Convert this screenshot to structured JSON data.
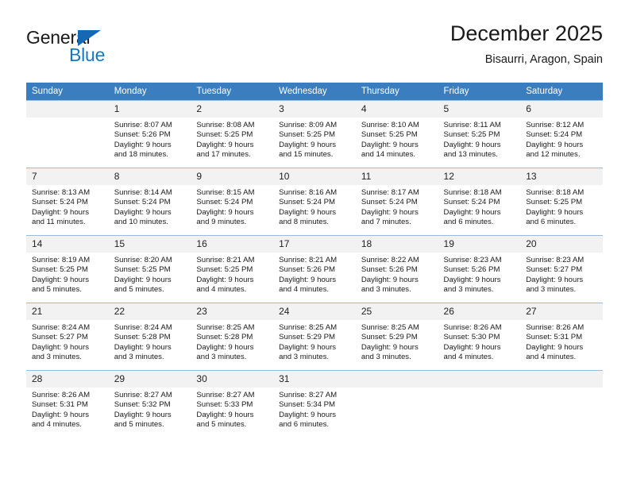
{
  "brand": {
    "name_part1": "General",
    "name_part2": "Blue",
    "accent_color": "#1479c4",
    "triangle_color": "#1668b3"
  },
  "header": {
    "title": "December 2025",
    "subtitle": "Bisaurri, Aragon, Spain"
  },
  "calendar": {
    "header_bg": "#3a7ebf",
    "daynum_bg": "#f2f2f2",
    "weekday_headers": [
      "Sunday",
      "Monday",
      "Tuesday",
      "Wednesday",
      "Thursday",
      "Friday",
      "Saturday"
    ],
    "weeks": [
      [
        {
          "day": "",
          "lines": []
        },
        {
          "day": "1",
          "lines": [
            "Sunrise: 8:07 AM",
            "Sunset: 5:26 PM",
            "Daylight: 9 hours",
            "and 18 minutes."
          ]
        },
        {
          "day": "2",
          "lines": [
            "Sunrise: 8:08 AM",
            "Sunset: 5:25 PM",
            "Daylight: 9 hours",
            "and 17 minutes."
          ]
        },
        {
          "day": "3",
          "lines": [
            "Sunrise: 8:09 AM",
            "Sunset: 5:25 PM",
            "Daylight: 9 hours",
            "and 15 minutes."
          ]
        },
        {
          "day": "4",
          "lines": [
            "Sunrise: 8:10 AM",
            "Sunset: 5:25 PM",
            "Daylight: 9 hours",
            "and 14 minutes."
          ]
        },
        {
          "day": "5",
          "lines": [
            "Sunrise: 8:11 AM",
            "Sunset: 5:25 PM",
            "Daylight: 9 hours",
            "and 13 minutes."
          ]
        },
        {
          "day": "6",
          "lines": [
            "Sunrise: 8:12 AM",
            "Sunset: 5:24 PM",
            "Daylight: 9 hours",
            "and 12 minutes."
          ]
        }
      ],
      [
        {
          "day": "7",
          "lines": [
            "Sunrise: 8:13 AM",
            "Sunset: 5:24 PM",
            "Daylight: 9 hours",
            "and 11 minutes."
          ]
        },
        {
          "day": "8",
          "lines": [
            "Sunrise: 8:14 AM",
            "Sunset: 5:24 PM",
            "Daylight: 9 hours",
            "and 10 minutes."
          ]
        },
        {
          "day": "9",
          "lines": [
            "Sunrise: 8:15 AM",
            "Sunset: 5:24 PM",
            "Daylight: 9 hours",
            "and 9 minutes."
          ]
        },
        {
          "day": "10",
          "lines": [
            "Sunrise: 8:16 AM",
            "Sunset: 5:24 PM",
            "Daylight: 9 hours",
            "and 8 minutes."
          ]
        },
        {
          "day": "11",
          "lines": [
            "Sunrise: 8:17 AM",
            "Sunset: 5:24 PM",
            "Daylight: 9 hours",
            "and 7 minutes."
          ]
        },
        {
          "day": "12",
          "lines": [
            "Sunrise: 8:18 AM",
            "Sunset: 5:24 PM",
            "Daylight: 9 hours",
            "and 6 minutes."
          ]
        },
        {
          "day": "13",
          "lines": [
            "Sunrise: 8:18 AM",
            "Sunset: 5:25 PM",
            "Daylight: 9 hours",
            "and 6 minutes."
          ]
        }
      ],
      [
        {
          "day": "14",
          "lines": [
            "Sunrise: 8:19 AM",
            "Sunset: 5:25 PM",
            "Daylight: 9 hours",
            "and 5 minutes."
          ]
        },
        {
          "day": "15",
          "lines": [
            "Sunrise: 8:20 AM",
            "Sunset: 5:25 PM",
            "Daylight: 9 hours",
            "and 5 minutes."
          ]
        },
        {
          "day": "16",
          "lines": [
            "Sunrise: 8:21 AM",
            "Sunset: 5:25 PM",
            "Daylight: 9 hours",
            "and 4 minutes."
          ]
        },
        {
          "day": "17",
          "lines": [
            "Sunrise: 8:21 AM",
            "Sunset: 5:26 PM",
            "Daylight: 9 hours",
            "and 4 minutes."
          ]
        },
        {
          "day": "18",
          "lines": [
            "Sunrise: 8:22 AM",
            "Sunset: 5:26 PM",
            "Daylight: 9 hours",
            "and 3 minutes."
          ]
        },
        {
          "day": "19",
          "lines": [
            "Sunrise: 8:23 AM",
            "Sunset: 5:26 PM",
            "Daylight: 9 hours",
            "and 3 minutes."
          ]
        },
        {
          "day": "20",
          "lines": [
            "Sunrise: 8:23 AM",
            "Sunset: 5:27 PM",
            "Daylight: 9 hours",
            "and 3 minutes."
          ]
        }
      ],
      [
        {
          "day": "21",
          "lines": [
            "Sunrise: 8:24 AM",
            "Sunset: 5:27 PM",
            "Daylight: 9 hours",
            "and 3 minutes."
          ]
        },
        {
          "day": "22",
          "lines": [
            "Sunrise: 8:24 AM",
            "Sunset: 5:28 PM",
            "Daylight: 9 hours",
            "and 3 minutes."
          ]
        },
        {
          "day": "23",
          "lines": [
            "Sunrise: 8:25 AM",
            "Sunset: 5:28 PM",
            "Daylight: 9 hours",
            "and 3 minutes."
          ]
        },
        {
          "day": "24",
          "lines": [
            "Sunrise: 8:25 AM",
            "Sunset: 5:29 PM",
            "Daylight: 9 hours",
            "and 3 minutes."
          ]
        },
        {
          "day": "25",
          "lines": [
            "Sunrise: 8:25 AM",
            "Sunset: 5:29 PM",
            "Daylight: 9 hours",
            "and 3 minutes."
          ]
        },
        {
          "day": "26",
          "lines": [
            "Sunrise: 8:26 AM",
            "Sunset: 5:30 PM",
            "Daylight: 9 hours",
            "and 4 minutes."
          ]
        },
        {
          "day": "27",
          "lines": [
            "Sunrise: 8:26 AM",
            "Sunset: 5:31 PM",
            "Daylight: 9 hours",
            "and 4 minutes."
          ]
        }
      ],
      [
        {
          "day": "28",
          "lines": [
            "Sunrise: 8:26 AM",
            "Sunset: 5:31 PM",
            "Daylight: 9 hours",
            "and 4 minutes."
          ]
        },
        {
          "day": "29",
          "lines": [
            "Sunrise: 8:27 AM",
            "Sunset: 5:32 PM",
            "Daylight: 9 hours",
            "and 5 minutes."
          ]
        },
        {
          "day": "30",
          "lines": [
            "Sunrise: 8:27 AM",
            "Sunset: 5:33 PM",
            "Daylight: 9 hours",
            "and 5 minutes."
          ]
        },
        {
          "day": "31",
          "lines": [
            "Sunrise: 8:27 AM",
            "Sunset: 5:34 PM",
            "Daylight: 9 hours",
            "and 6 minutes."
          ]
        },
        {
          "day": "",
          "lines": []
        },
        {
          "day": "",
          "lines": []
        },
        {
          "day": "",
          "lines": []
        }
      ]
    ]
  }
}
